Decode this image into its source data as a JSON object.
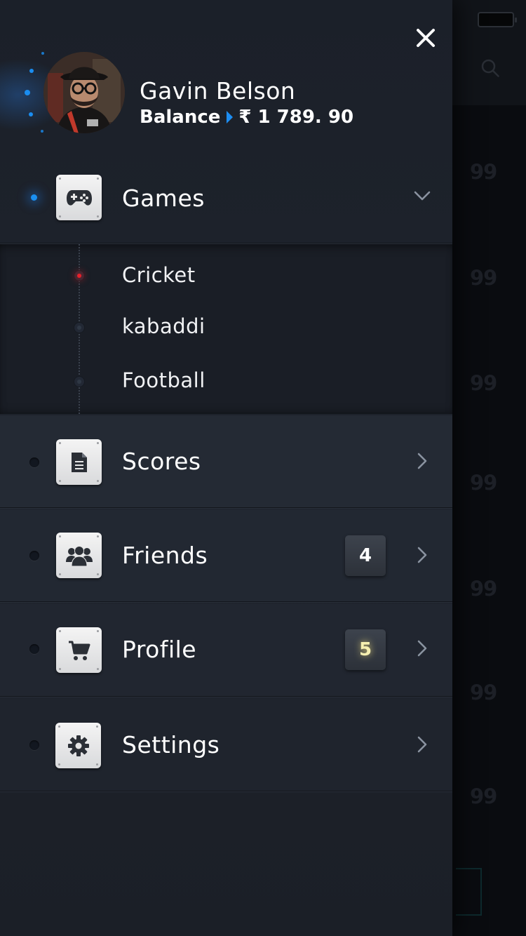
{
  "user": {
    "name": "Gavin Belson",
    "balance_label": "Balance",
    "balance_value": "₹ 1 789. 90"
  },
  "background": {
    "scores": [
      "99",
      "99",
      "99",
      "99",
      "99",
      "99",
      "99"
    ]
  },
  "menu": {
    "games": {
      "label": "Games",
      "icon": "gamepad-icon",
      "expanded": true
    },
    "games_submenu": [
      {
        "label": "Cricket",
        "active": true
      },
      {
        "label": "kabaddi",
        "active": false
      },
      {
        "label": "Football",
        "active": false
      }
    ],
    "scores": {
      "label": "Scores",
      "icon": "document-icon"
    },
    "friends": {
      "label": "Friends",
      "icon": "group-icon",
      "badge": "4"
    },
    "profile": {
      "label": "Profile",
      "icon": "cart-icon",
      "badge": "5"
    },
    "settings": {
      "label": "Settings",
      "icon": "gear-icon"
    }
  },
  "colors": {
    "accent": "#1a8ff0",
    "active_sub": "#e8202a",
    "drawer_bg": "#1e232c",
    "badge_glow": "#f5efb0"
  }
}
